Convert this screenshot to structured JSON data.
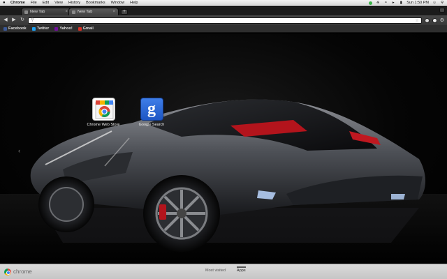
{
  "menubar": {
    "app_name": "Chrome",
    "items": [
      "File",
      "Edit",
      "View",
      "History",
      "Bookmarks",
      "Window",
      "Help"
    ],
    "clock": "Sun 1:50 PM",
    "status_icons": [
      "green-status-icon",
      "bluetooth-icon",
      "wifi-icon",
      "volume-icon",
      "battery-icon",
      "user-icon",
      "spotlight-icon"
    ]
  },
  "tabs": [
    {
      "label": "New Tab",
      "active": false
    },
    {
      "label": "New Tab",
      "active": true
    }
  ],
  "toolbar": {
    "url_value": "",
    "url_placeholder": ""
  },
  "bookmarks": [
    {
      "label": "Facebook",
      "color": "#3b5998"
    },
    {
      "label": "Twitter",
      "color": "#1da1f2"
    },
    {
      "label": "Yahoo!",
      "color": "#720e9e"
    },
    {
      "label": "Gmail",
      "color": "#d93025"
    }
  ],
  "apps": [
    {
      "label": "Chrome Web Store",
      "icon": "chrome-web-store-icon"
    },
    {
      "label": "Google Search",
      "icon": "google-search-icon",
      "glyph": "g"
    }
  ],
  "footer": {
    "logo_text": "chrome",
    "tabs": [
      {
        "label": "Most visited",
        "active": false
      },
      {
        "label": "Apps",
        "active": true
      }
    ]
  }
}
